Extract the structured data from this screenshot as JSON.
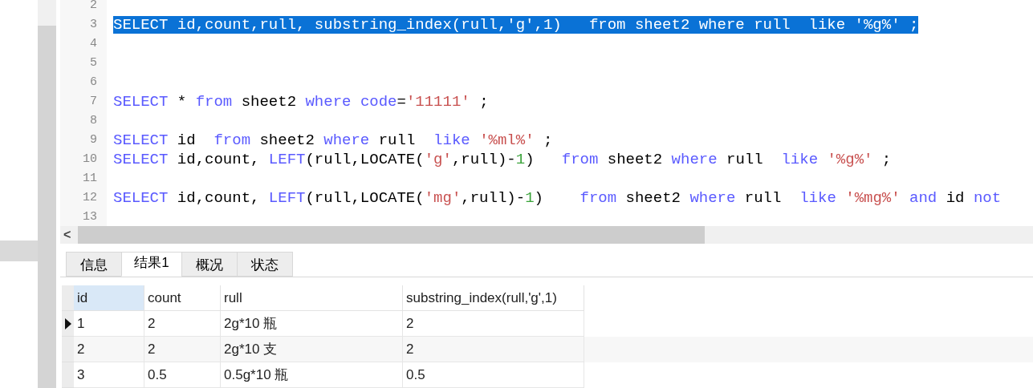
{
  "editor": {
    "lines": [
      {
        "number": "2",
        "selected": false
      },
      {
        "number": "3",
        "selected": true,
        "tokens": [
          {
            "kind": "plain",
            "text": "SELECT id,count,rull, substring_index(rull,'g',1)   from sheet2 where rull  like '%g%' ;"
          }
        ]
      },
      {
        "number": "4",
        "selected": false
      },
      {
        "number": "5",
        "selected": false
      },
      {
        "number": "6",
        "selected": false
      },
      {
        "number": "7",
        "selected": false,
        "tokens": [
          {
            "kind": "keyword",
            "text": "SELECT"
          },
          {
            "kind": "plain",
            "text": " * "
          },
          {
            "kind": "keyword",
            "text": "from"
          },
          {
            "kind": "plain",
            "text": " sheet2 "
          },
          {
            "kind": "keyword",
            "text": "where code"
          },
          {
            "kind": "plain",
            "text": "="
          },
          {
            "kind": "string",
            "text": "'11111'"
          },
          {
            "kind": "plain",
            "text": " ;"
          }
        ]
      },
      {
        "number": "8",
        "selected": false
      },
      {
        "number": "9",
        "selected": false,
        "tokens": [
          {
            "kind": "keyword",
            "text": "SELECT"
          },
          {
            "kind": "plain",
            "text": " id  "
          },
          {
            "kind": "keyword",
            "text": "from"
          },
          {
            "kind": "plain",
            "text": " sheet2 "
          },
          {
            "kind": "keyword",
            "text": "where"
          },
          {
            "kind": "plain",
            "text": " rull  "
          },
          {
            "kind": "keyword",
            "text": "like "
          },
          {
            "kind": "string",
            "text": "'%ml%'"
          },
          {
            "kind": "plain",
            "text": " ;"
          }
        ]
      },
      {
        "number": "10",
        "selected": false,
        "tokens": [
          {
            "kind": "keyword",
            "text": "SELECT"
          },
          {
            "kind": "plain",
            "text": " id,count, "
          },
          {
            "kind": "keyword",
            "text": "LEFT"
          },
          {
            "kind": "plain",
            "text": "(rull,LOCATE("
          },
          {
            "kind": "string",
            "text": "'g'"
          },
          {
            "kind": "plain",
            "text": ",rull)-"
          },
          {
            "kind": "number",
            "text": "1"
          },
          {
            "kind": "plain",
            "text": ")   "
          },
          {
            "kind": "keyword",
            "text": "from"
          },
          {
            "kind": "plain",
            "text": " sheet2 "
          },
          {
            "kind": "keyword",
            "text": "where"
          },
          {
            "kind": "plain",
            "text": " rull  "
          },
          {
            "kind": "keyword",
            "text": "like "
          },
          {
            "kind": "string",
            "text": "'%g%'"
          },
          {
            "kind": "plain",
            "text": " ;"
          }
        ]
      },
      {
        "number": "11",
        "selected": false
      },
      {
        "number": "12",
        "selected": false,
        "tokens": [
          {
            "kind": "keyword",
            "text": "SELECT"
          },
          {
            "kind": "plain",
            "text": " id,count, "
          },
          {
            "kind": "keyword",
            "text": "LEFT"
          },
          {
            "kind": "plain",
            "text": "(rull,LOCATE("
          },
          {
            "kind": "string",
            "text": "'mg'"
          },
          {
            "kind": "plain",
            "text": ",rull)-"
          },
          {
            "kind": "number",
            "text": "1"
          },
          {
            "kind": "plain",
            "text": ")    "
          },
          {
            "kind": "keyword",
            "text": "from"
          },
          {
            "kind": "plain",
            "text": " sheet2 "
          },
          {
            "kind": "keyword",
            "text": "where"
          },
          {
            "kind": "plain",
            "text": " rull  "
          },
          {
            "kind": "keyword",
            "text": "like "
          },
          {
            "kind": "string",
            "text": "'%mg%'"
          },
          {
            "kind": "keyword",
            "text": " and"
          },
          {
            "kind": "plain",
            "text": " id "
          },
          {
            "kind": "keyword",
            "text": "not"
          }
        ]
      },
      {
        "number": "13",
        "selected": false
      }
    ],
    "scroll_left": "<"
  },
  "tabs": [
    {
      "label": "信息",
      "selected": false
    },
    {
      "label": "结果1",
      "selected": true
    },
    {
      "label": "概况",
      "selected": false
    },
    {
      "label": "状态",
      "selected": false
    }
  ],
  "table": {
    "columns": [
      {
        "label": "id",
        "selected": true
      },
      {
        "label": "count",
        "selected": false
      },
      {
        "label": "rull",
        "selected": false
      },
      {
        "label": "substring_index(rull,'g',1)",
        "selected": false
      }
    ],
    "rows": [
      {
        "current": true,
        "cells": [
          "1",
          "2",
          "2g*10 瓶",
          "2"
        ]
      },
      {
        "current": false,
        "cells": [
          "2",
          "2",
          "2g*10 支",
          "2"
        ]
      },
      {
        "current": false,
        "cells": [
          "3",
          "0.5",
          "0.5g*10 瓶",
          "0.5"
        ]
      }
    ]
  }
}
